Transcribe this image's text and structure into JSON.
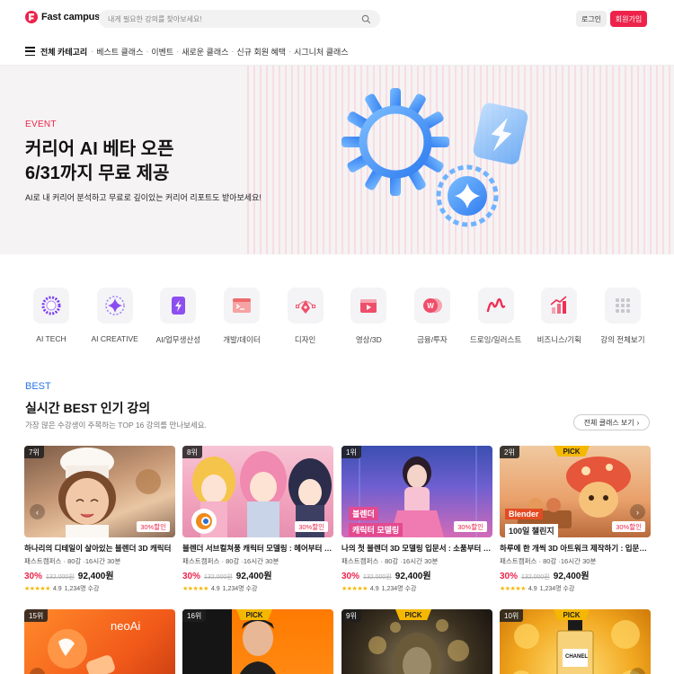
{
  "header": {
    "logo_text": "Fast campus",
    "search_placeholder": "내게 필요한 강의를 찾아보세요!",
    "login_label": "로그인",
    "signup_label": "회원가입"
  },
  "nav": {
    "all_label": "전체 카테고리",
    "items": [
      "베스트 클래스",
      "이벤트",
      "새로운 클래스",
      "신규 회원 혜택",
      "시그니처 클래스"
    ]
  },
  "hero": {
    "tag": "EVENT",
    "title_line1": "커리어 AI 베타 오픈",
    "title_line2": "6/31까지 무료 제공",
    "subtitle": "AI로 내 커리어 분석하고 무료로 깊이있는 커리어 리포트도 받아보세요!"
  },
  "categories": [
    {
      "label": "AI TECH",
      "icon": "ai-tech-icon"
    },
    {
      "label": "AI CREATIVE",
      "icon": "ai-creative-icon"
    },
    {
      "label": "AI/업무생산성",
      "icon": "productivity-icon"
    },
    {
      "label": "개발/데이터",
      "icon": "terminal-icon"
    },
    {
      "label": "디자인",
      "icon": "pen-tool-icon"
    },
    {
      "label": "영상/3D",
      "icon": "video-icon"
    },
    {
      "label": "금융/투자",
      "icon": "coin-icon"
    },
    {
      "label": "드로잉/일러스트",
      "icon": "drawing-icon"
    },
    {
      "label": "비즈니스/기획",
      "icon": "chart-icon"
    },
    {
      "label": "강의 전체보기",
      "icon": "grid-icon"
    }
  ],
  "best": {
    "tag": "BEST",
    "title": "실시간 BEST 인기 강의",
    "subtitle": "가장 많은 수강생이 주목하는 TOP 16 강의를 만나보세요.",
    "more_label": "전체 클래스 보기",
    "more_arrow": "›"
  },
  "cards": [
    {
      "rank": "7위",
      "pick": "",
      "badge": "30%할인",
      "title": "하나리의 디테일이 살아있는 블렌더 3D 캐릭터",
      "meta": "패스트캠퍼스 · 80강 ·16시간 30분",
      "pct": "30%",
      "orig": "132,000원",
      "price": "92,400원",
      "stars": "★★★★★",
      "rating": "4.9",
      "students": "1,234명 수강",
      "labels": []
    },
    {
      "rank": "8위",
      "pick": "",
      "badge": "30%할인",
      "title": "블렌더 서브컬쳐풍 캐릭터 모델링 : 헤어부터 의상까지",
      "meta": "패스트캠퍼스 · 80강 ·16시간 30분",
      "pct": "30%",
      "orig": "132,000원",
      "price": "92,400원",
      "stars": "★★★★★",
      "rating": "4.9",
      "students": "1,234명 수강",
      "labels": []
    },
    {
      "rank": "1위",
      "pick": "",
      "badge": "30%할인",
      "title": "나의 첫 블렌더 3D 모델링 입문서 : 소품부터 캐릭터까지",
      "meta": "패스트캠퍼스 · 80강 ·16시간 30분",
      "pct": "30%",
      "orig": "132,000원",
      "price": "92,400원",
      "stars": "★★★★★",
      "rating": "4.9",
      "students": "1,234명 수강",
      "labels": [
        "블렌더",
        "캐릭터 모델링"
      ]
    },
    {
      "rank": "2위",
      "pick": "PICK",
      "badge": "30%할인",
      "title": "하루에 한 개씩 3D 아트워크 제작하기 : 입문부터 완성까지",
      "meta": "패스트캠퍼스 · 80강 ·16시간 30분",
      "pct": "30%",
      "orig": "132,000원",
      "price": "92,400원",
      "stars": "★★★★★",
      "rating": "4.9",
      "students": "1,234명 수강",
      "labels": [
        "Blender",
        "100일 챌린지"
      ]
    },
    {
      "rank": "15위",
      "pick": "",
      "badge": "",
      "title": "",
      "meta": "",
      "pct": "",
      "orig": "",
      "price": "",
      "stars": "",
      "rating": "",
      "students": "",
      "labels": [
        "neoAi"
      ]
    },
    {
      "rank": "16위",
      "pick": "PICK",
      "badge": "",
      "title": "",
      "meta": "",
      "pct": "",
      "orig": "",
      "price": "",
      "stars": "",
      "rating": "",
      "students": "",
      "labels": []
    },
    {
      "rank": "9위",
      "pick": "PICK",
      "badge": "",
      "title": "",
      "meta": "",
      "pct": "",
      "orig": "",
      "price": "",
      "stars": "",
      "rating": "",
      "students": "",
      "labels": []
    },
    {
      "rank": "10위",
      "pick": "PICK",
      "badge": "",
      "title": "",
      "meta": "",
      "pct": "",
      "orig": "",
      "price": "",
      "stars": "",
      "rating": "",
      "students": "",
      "labels": [
        "CHANEL"
      ]
    }
  ],
  "carousel": {
    "prev": "‹",
    "next": "›"
  },
  "colors": {
    "brand": "#ed234b",
    "best_tag": "#2a76e8",
    "pick": "#f5b800"
  }
}
